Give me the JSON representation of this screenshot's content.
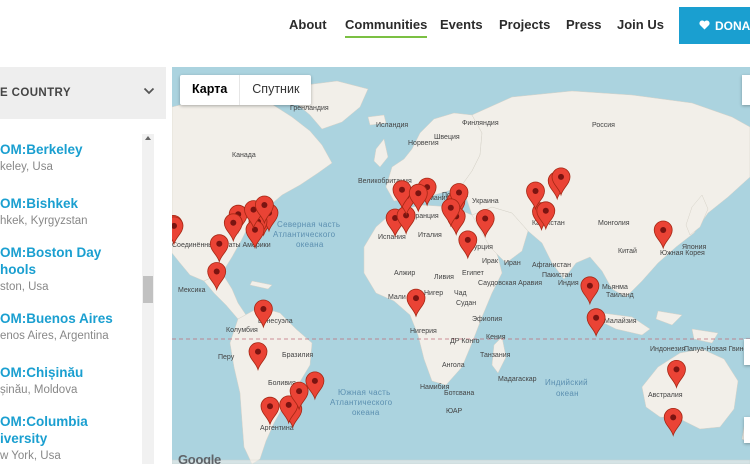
{
  "nav": {
    "items": [
      "About",
      "Communities",
      "Events",
      "Projects",
      "Press",
      "Join Us"
    ],
    "active": "Communities",
    "donate_label": "DONA"
  },
  "sidebar": {
    "country_label": "E COUNTRY",
    "items": [
      {
        "name": "OM:Berkeley",
        "location": "keley, Usa"
      },
      {
        "name": "OM:Bishkek",
        "location": "hkek, Kyrgyzstan"
      },
      {
        "name_line1": "OM:Boston Day",
        "name_line2": "hools",
        "location": "ston, Usa"
      },
      {
        "name": "OM:Buenos Aires",
        "location": "enos Aires, Argentina"
      },
      {
        "name": "OM:Chișinău",
        "location": "șinău, Moldova"
      },
      {
        "name_line1": "OM:Columbia",
        "name_line2": "iversity",
        "location": "w York, Usa"
      }
    ]
  },
  "map": {
    "type_map": "Карта",
    "type_satellite": "Спутник",
    "attribution": "Google",
    "oceans": {
      "north_atlantic_1": "Северная часть",
      "north_atlantic_2": "Атлантического",
      "north_atlantic_3": "океана",
      "south_atlantic_1": "Южная часть",
      "south_atlantic_2": "Атлантического",
      "south_atlantic_3": "океана",
      "indian_1": "Индийский",
      "indian_2": "океан"
    },
    "labels": [
      {
        "t": "Гренландия"
      },
      {
        "t": "Исландия"
      },
      {
        "t": "Швеция"
      },
      {
        "t": "Финляндия"
      },
      {
        "t": "Норвегия"
      },
      {
        "t": "Великобритания"
      },
      {
        "t": "Германия"
      },
      {
        "t": "Польша"
      },
      {
        "t": "Украина"
      },
      {
        "t": "Франция"
      },
      {
        "t": "Италия"
      },
      {
        "t": "Испания"
      },
      {
        "t": "Казахстан"
      },
      {
        "t": "Монголия"
      },
      {
        "t": "Китай"
      },
      {
        "t": "Япония"
      },
      {
        "t": "Южная Корея"
      },
      {
        "t": "Турция"
      },
      {
        "t": "Ирак"
      },
      {
        "t": "Иран"
      },
      {
        "t": "Афганистан"
      },
      {
        "t": "Пакистан"
      },
      {
        "t": "Индия"
      },
      {
        "t": "Мьянма"
      },
      {
        "t": "Таиланд"
      },
      {
        "t": "Малайзия"
      },
      {
        "t": "Индонезия"
      },
      {
        "t": "Египет"
      },
      {
        "t": "Ливия"
      },
      {
        "t": "Алжир"
      },
      {
        "t": "Мали"
      },
      {
        "t": "Нигер"
      },
      {
        "t": "Чад"
      },
      {
        "t": "Судан"
      },
      {
        "t": "Нигерия"
      },
      {
        "t": "Эфиопия"
      },
      {
        "t": "ДР Конго"
      },
      {
        "t": "Кения"
      },
      {
        "t": "Танзания"
      },
      {
        "t": "Ангола"
      },
      {
        "t": "Намибия"
      },
      {
        "t": "ЮАР"
      },
      {
        "t": "Ботсвана"
      },
      {
        "t": "Мадагаскар"
      },
      {
        "t": "Саудовская Аравия"
      },
      {
        "t": "Мексика"
      },
      {
        "t": "Венесуэла"
      },
      {
        "t": "Колумбия"
      },
      {
        "t": "Перу"
      },
      {
        "t": "Бразилия"
      },
      {
        "t": "Боливия"
      },
      {
        "t": "Аргентина"
      },
      {
        "t": "Австралия"
      },
      {
        "t": "Папуа-Новая Гвинея"
      },
      {
        "t": "Соединённые Штаты Америки"
      },
      {
        "t": "Канада"
      },
      {
        "t": "Россия"
      }
    ],
    "colors": {
      "water": "#abd3df",
      "land": "#f2efe9",
      "pin": "#ea4335",
      "accent": "#1a9fd0",
      "active_underline": "#7bc043"
    }
  },
  "markers": [
    {
      "lat": 37.9,
      "lon": -122.3
    },
    {
      "lat": 37.3,
      "lon": -121.9
    },
    {
      "lat": 40.7,
      "lon": -74.0
    },
    {
      "lat": 42.4,
      "lon": -71.1
    },
    {
      "lat": 41.9,
      "lon": -87.6
    },
    {
      "lat": 39.0,
      "lon": -77.0
    },
    {
      "lat": 35.8,
      "lon": -78.6
    },
    {
      "lat": 43.7,
      "lon": -79.4
    },
    {
      "lat": 45.5,
      "lon": -73.6
    },
    {
      "lat": 30.3,
      "lon": -97.7
    },
    {
      "lat": 38.5,
      "lon": -90.2
    },
    {
      "lat": 19.4,
      "lon": -99.1
    },
    {
      "lat": 4.7,
      "lon": -74.1
    },
    {
      "lat": -12.0,
      "lon": -77.0
    },
    {
      "lat": -23.5,
      "lon": -46.6
    },
    {
      "lat": -33.4,
      "lon": -70.6
    },
    {
      "lat": -34.6,
      "lon": -58.4
    },
    {
      "lat": -32.9,
      "lon": -60.6
    },
    {
      "lat": -27.5,
      "lon": -55.0
    },
    {
      "lat": 40.4,
      "lon": -3.7
    },
    {
      "lat": 41.4,
      "lon": 2.2
    },
    {
      "lat": 48.9,
      "lon": 2.3
    },
    {
      "lat": 51.5,
      "lon": 0.0
    },
    {
      "lat": 52.5,
      "lon": 13.4
    },
    {
      "lat": 50.1,
      "lon": 8.7
    },
    {
      "lat": 47.0,
      "lon": 28.8
    },
    {
      "lat": 50.4,
      "lon": 30.5
    },
    {
      "lat": 41.0,
      "lon": 29.0
    },
    {
      "lat": 44.4,
      "lon": 26.1
    },
    {
      "lat": 42.9,
      "lon": 74.6
    },
    {
      "lat": 43.2,
      "lon": 76.9
    },
    {
      "lat": 55.0,
      "lon": 83.0
    },
    {
      "lat": 56.5,
      "lon": 85.0
    },
    {
      "lat": 51.0,
      "lon": 71.4
    },
    {
      "lat": 31.8,
      "lon": 35.2
    },
    {
      "lat": 40.2,
      "lon": 44.5
    },
    {
      "lat": 9.0,
      "lon": 7.5
    },
    {
      "lat": 35.7,
      "lon": 139.7
    },
    {
      "lat": 13.8,
      "lon": 100.5
    },
    {
      "lat": 1.3,
      "lon": 103.8
    },
    {
      "lat": -19.0,
      "lon": 146.8
    },
    {
      "lat": -37.8,
      "lon": 145.0
    }
  ]
}
